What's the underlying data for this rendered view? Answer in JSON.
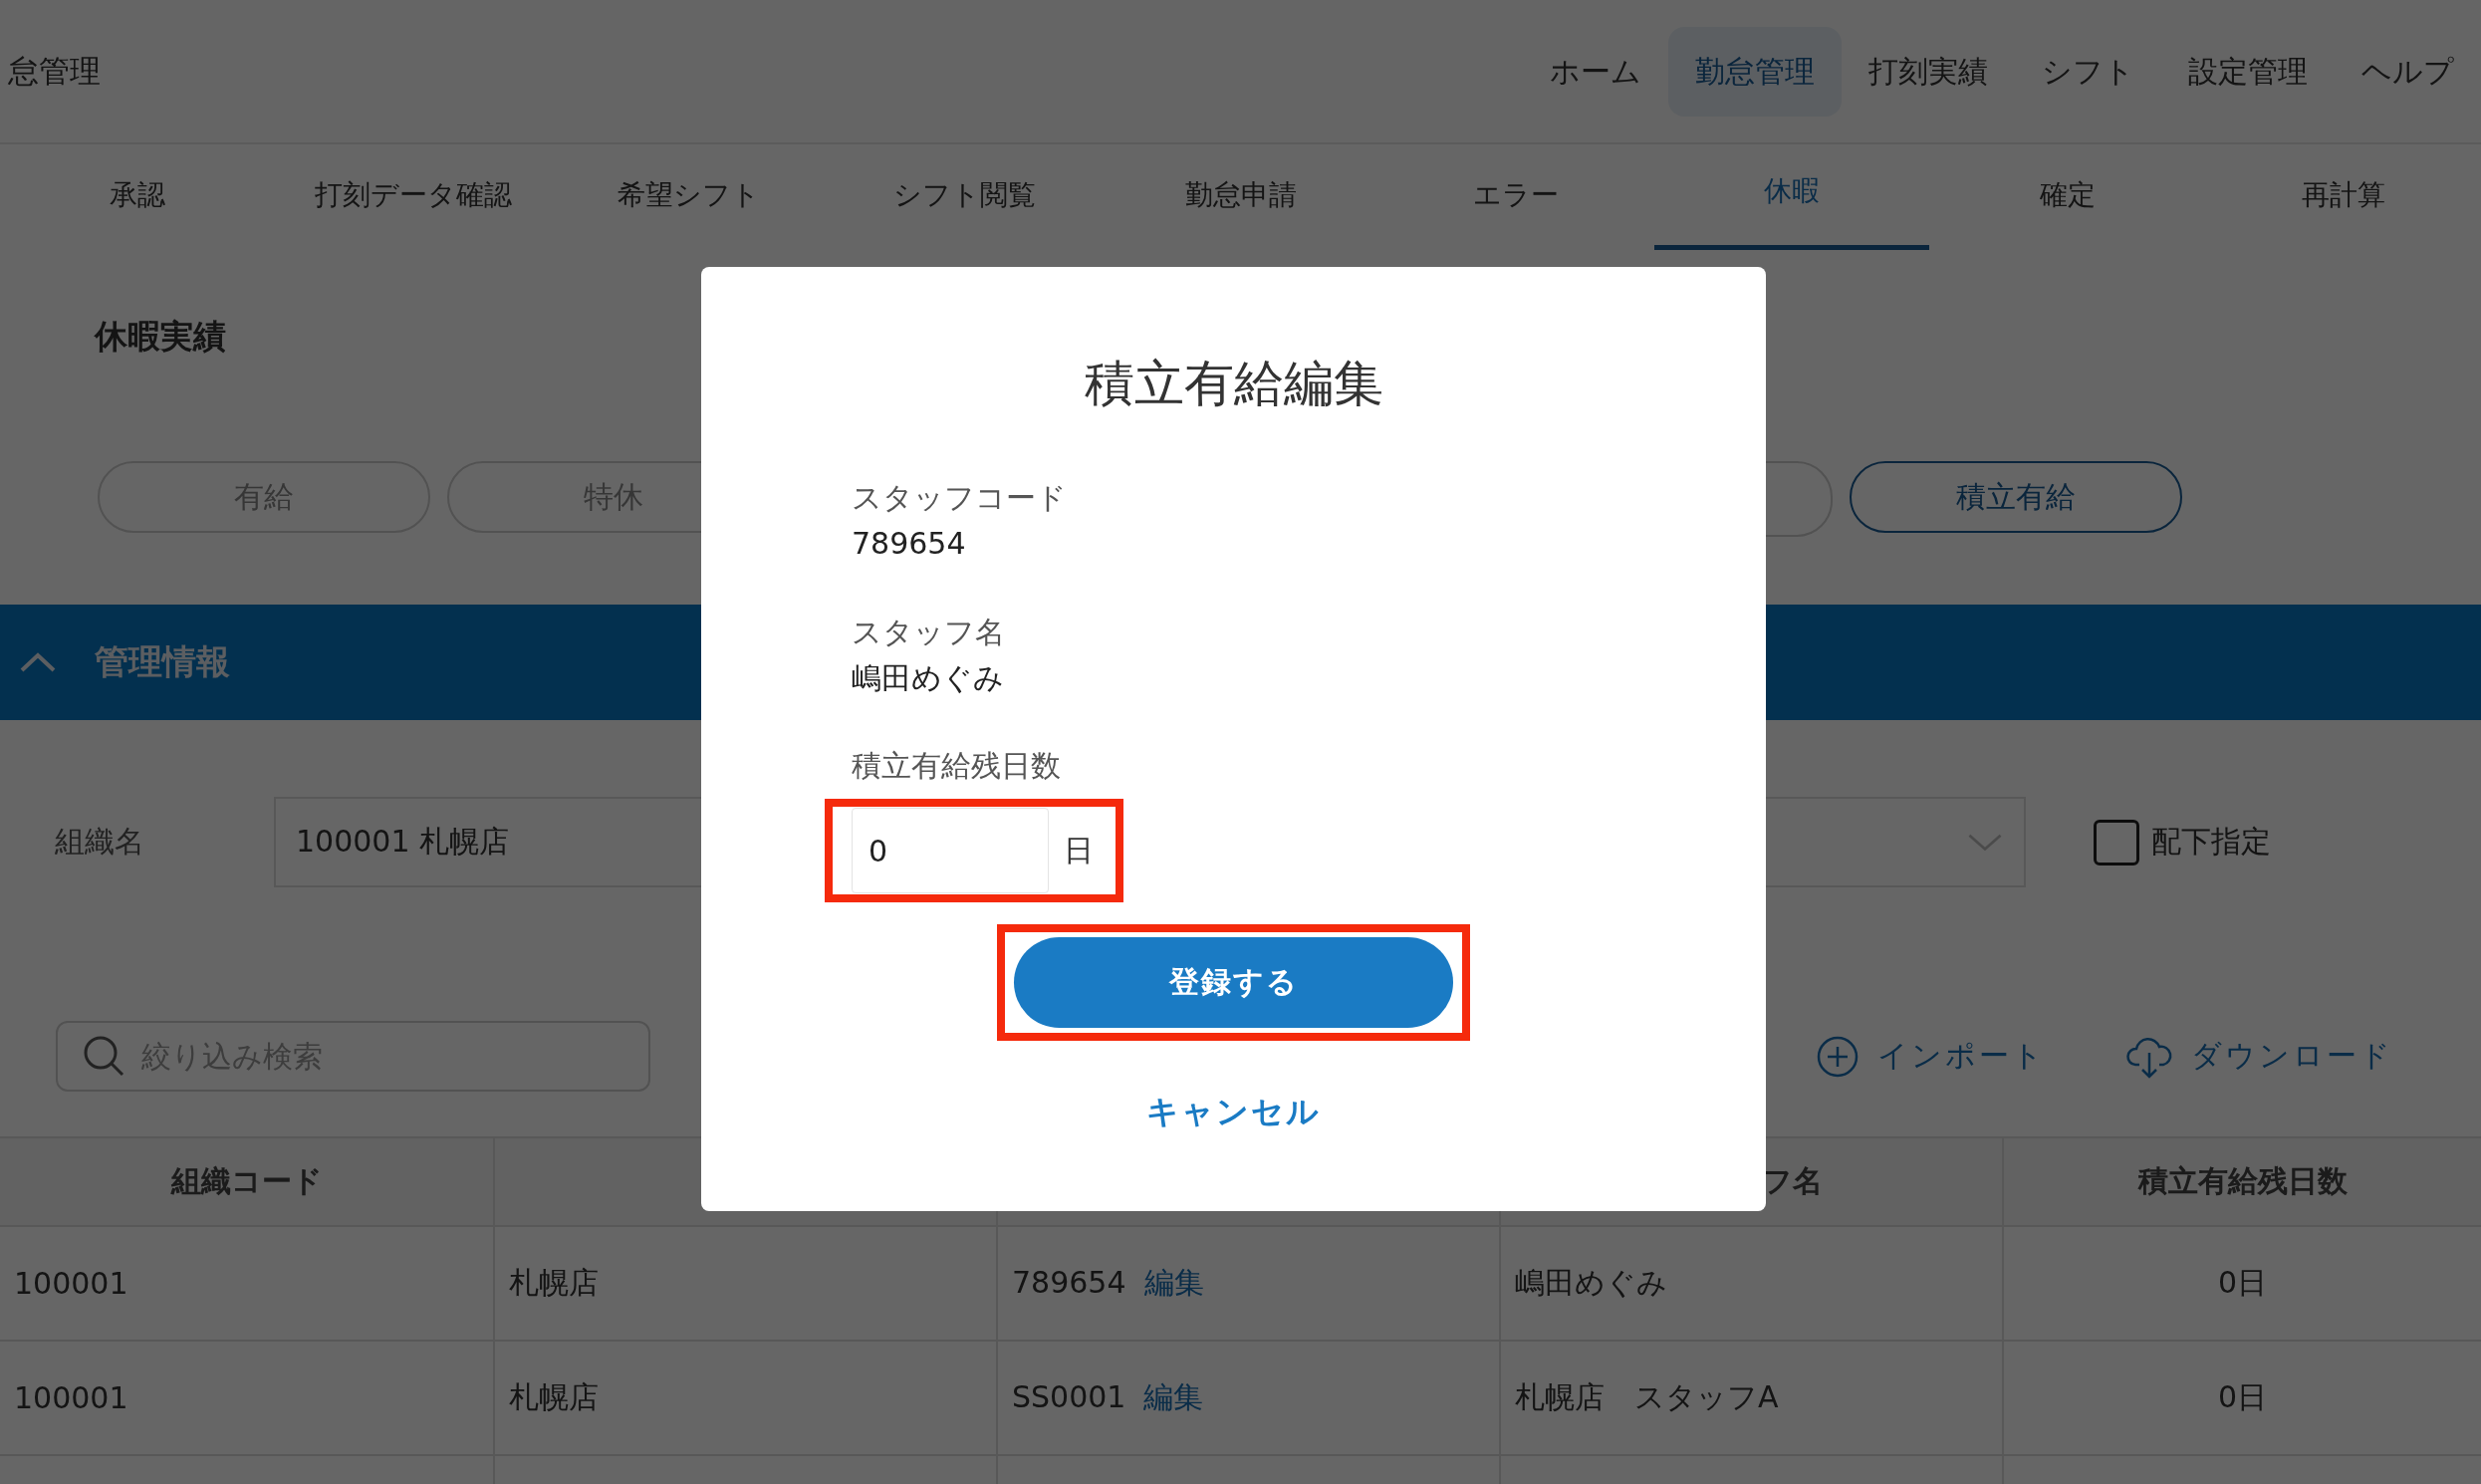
{
  "header": {
    "title": "怠管理",
    "nav": [
      {
        "label": "ホーム",
        "selected": false
      },
      {
        "label": "勤怠管理",
        "selected": true
      },
      {
        "label": "打刻実績",
        "selected": false
      },
      {
        "label": "シフト",
        "selected": false
      },
      {
        "label": "設定管理",
        "selected": false
      },
      {
        "label": "ヘルプ",
        "selected": false
      }
    ]
  },
  "subtabs": [
    {
      "label": "承認",
      "selected": false
    },
    {
      "label": "打刻データ確認",
      "selected": false
    },
    {
      "label": "希望シフト",
      "selected": false
    },
    {
      "label": "シフト閲覧",
      "selected": false
    },
    {
      "label": "勤怠申請",
      "selected": false
    },
    {
      "label": "エラー",
      "selected": false
    },
    {
      "label": "休暇",
      "selected": true
    },
    {
      "label": "確定",
      "selected": false
    },
    {
      "label": "再計算",
      "selected": false
    }
  ],
  "section": {
    "title": "休暇実績"
  },
  "leave_types": [
    {
      "label": "有給",
      "selected": false
    },
    {
      "label": "特休",
      "selected": false
    },
    {
      "label": "積立有給",
      "selected": true
    }
  ],
  "panel": {
    "title": "管理情報",
    "expanded": true
  },
  "filters": {
    "org_label": "組織名",
    "org_value": "100001 札幌店",
    "subordinates": {
      "label": "配下指定",
      "checked": false
    },
    "search": {
      "placeholder": "絞り込み検索"
    }
  },
  "actions": [
    {
      "kind": "import",
      "label": "インポート"
    },
    {
      "kind": "download",
      "label": "ダウンロード"
    }
  ],
  "table": {
    "columns": [
      "組織コード",
      null,
      null,
      "フ名",
      "積立有給残日数"
    ],
    "rows": [
      {
        "org_code": "100001",
        "org_name": "札幌店",
        "staff_code": "789654",
        "edit_link": "編集",
        "staff_name": "嶋田めぐみ",
        "days": "0日"
      },
      {
        "org_code": "100001",
        "org_name": "札幌店",
        "staff_code": "SS0001",
        "edit_link": "編集",
        "staff_name": "札幌店　スタッフA",
        "days": "0日"
      }
    ]
  },
  "modal": {
    "title": "積立有給編集",
    "fields": [
      {
        "label": "スタッフコード",
        "value": "789654"
      },
      {
        "label": "スタッフ名",
        "value": "嶋田めぐみ"
      }
    ],
    "input": {
      "label": "積立有給残日数",
      "value": "0",
      "unit": "日",
      "highlighted": true
    },
    "submit": {
      "label": "登録する",
      "highlighted": true
    },
    "cancel": "キャンセル"
  }
}
